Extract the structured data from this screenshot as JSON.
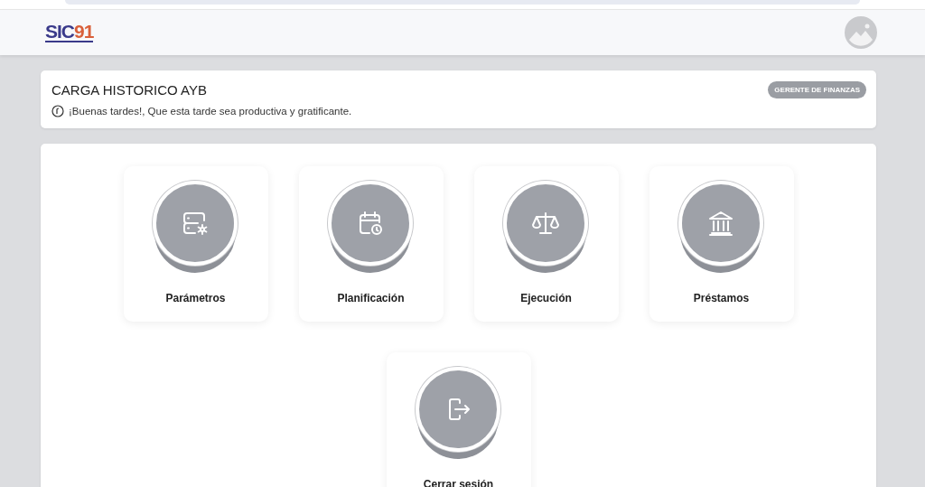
{
  "header": {
    "logo": [
      "SIC",
      "91"
    ]
  },
  "welcome": {
    "title": "CARGA HISTORICO AYB",
    "role": "GERENTE DE FINANZAS",
    "greeting": "¡Buenas tardes!, Que esta tarde sea productiva y gratificante."
  },
  "modules": [
    {
      "label": "Parámetros",
      "kind": "server"
    },
    {
      "label": "Planificación",
      "kind": "calendar"
    },
    {
      "label": "Ejecución",
      "kind": "scale"
    },
    {
      "label": "Préstamos",
      "kind": "bank"
    },
    {
      "label": "Cerrar sesión",
      "kind": "logout"
    }
  ]
}
